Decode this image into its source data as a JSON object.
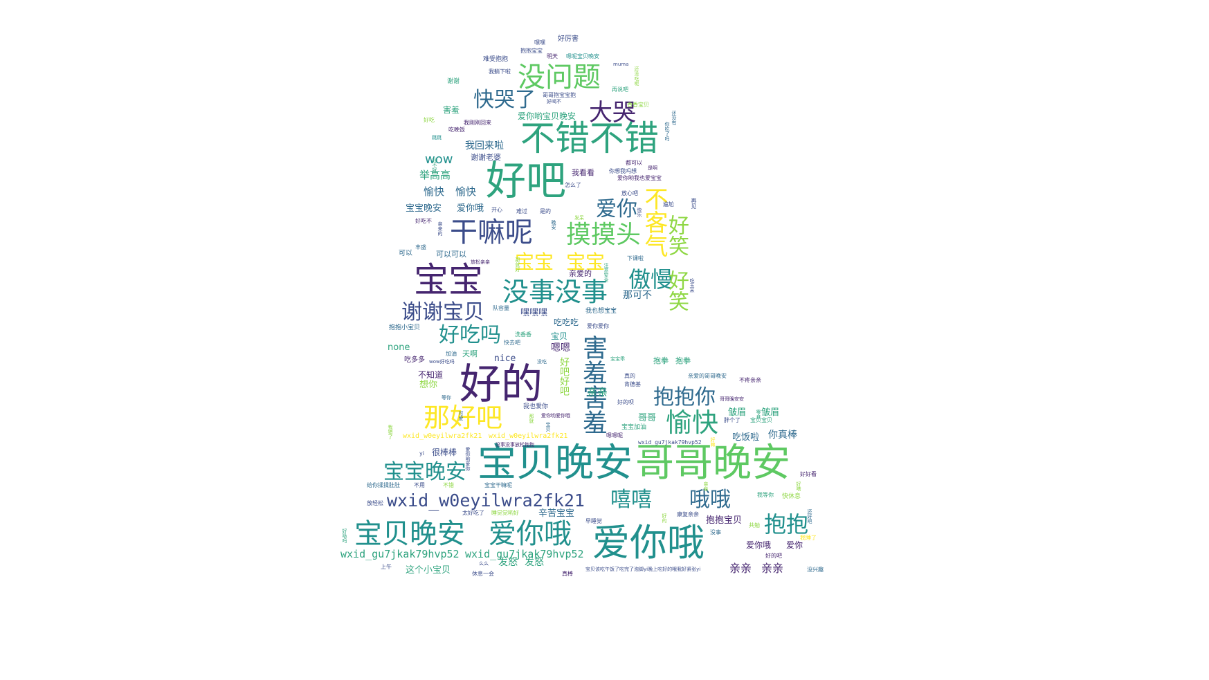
{
  "palette": {
    "dark_purple": "#45256f",
    "indigo": "#3b4c8a",
    "blue": "#2f6a8e",
    "teal": "#21908d",
    "green_teal": "#2ea37e",
    "green": "#5ec962",
    "light_green": "#8fd744",
    "yellow": "#fde725"
  },
  "words": [
    {
      "text": "宝贝晚安"
    },
    {
      "text": "哥哥晚安"
    },
    {
      "text": "好的"
    },
    {
      "text": "爱你哦"
    },
    {
      "text": "宝宝"
    },
    {
      "text": "好吧"
    },
    {
      "text": "不错不错"
    },
    {
      "text": "没问题"
    },
    {
      "text": "干嘛呢"
    },
    {
      "text": "摸摸头"
    },
    {
      "text": "没事没事"
    },
    {
      "text": "宝贝晚安"
    },
    {
      "text": "爱你哦"
    },
    {
      "text": "谢谢宝贝"
    },
    {
      "text": "好吃吗"
    },
    {
      "text": "那好吧"
    },
    {
      "text": "宝宝晚安"
    },
    {
      "text": "wxid_w0eyilwra2fk21"
    },
    {
      "text": "快哭了"
    },
    {
      "text": "大哭"
    },
    {
      "text": "爱你"
    },
    {
      "text": "宝宝"
    },
    {
      "text": "宝宝"
    },
    {
      "text": "傲慢"
    },
    {
      "text": "抱抱你"
    },
    {
      "text": "愉快"
    },
    {
      "text": "嘻嘻"
    },
    {
      "text": "哦哦"
    },
    {
      "text": "抱抱"
    },
    {
      "text": "害羞害羞"
    },
    {
      "text": "不客气"
    },
    {
      "text": "好笑"
    },
    {
      "text": "好笑"
    },
    {
      "text": "wxid_gu7jkak79hvp52"
    },
    {
      "text": "wxid_gu7jkak79hvp52"
    },
    {
      "text": "wow"
    },
    {
      "text": "我回来啦"
    },
    {
      "text": "谢谢老婆"
    },
    {
      "text": "举高高"
    },
    {
      "text": "愉快"
    },
    {
      "text": "愉快"
    },
    {
      "text": "宝宝晚安"
    },
    {
      "text": "爱你哦"
    },
    {
      "text": "爱你哟宝贝晚安"
    },
    {
      "text": "害羞"
    },
    {
      "text": "嘿嘿嘿"
    },
    {
      "text": "吃吃吃"
    },
    {
      "text": "那可不"
    },
    {
      "text": "嗯嗯"
    },
    {
      "text": "宝贝"
    },
    {
      "text": "好吧好吧"
    },
    {
      "text": "亲亲"
    },
    {
      "text": "哥哥"
    },
    {
      "text": "皱眉"
    },
    {
      "text": "皱眉"
    },
    {
      "text": "吃饭啦"
    },
    {
      "text": "你真棒"
    },
    {
      "text": "辛苦宝宝"
    },
    {
      "text": "抱抱宝贝"
    },
    {
      "text": "爱你哦"
    },
    {
      "text": "爱你"
    },
    {
      "text": "亲亲"
    },
    {
      "text": "亲亲"
    },
    {
      "text": "发怒"
    },
    {
      "text": "发怒"
    },
    {
      "text": "这个小宝贝"
    },
    {
      "text": "很棒棒"
    },
    {
      "text": "none"
    },
    {
      "text": "nice"
    },
    {
      "text": "天啊"
    },
    {
      "text": "吃多多"
    },
    {
      "text": "不知道"
    },
    {
      "text": "想你"
    },
    {
      "text": "抱拳"
    },
    {
      "text": "抱拳"
    },
    {
      "text": "可以可以"
    },
    {
      "text": "亲爱的"
    },
    {
      "text": "我看看"
    },
    {
      "text": "wxid_w0eyilwra2fk21"
    },
    {
      "text": "wxid_w0eyilwra2fk21"
    },
    {
      "text": "可以"
    },
    {
      "text": "好厉害"
    },
    {
      "text": "抱抱宝宝"
    },
    {
      "text": "嘿嘿"
    },
    {
      "text": "难受抱抱"
    },
    {
      "text": "明天"
    },
    {
      "text": "我躺下啦"
    },
    {
      "text": "嗯呢宝贝晚安"
    },
    {
      "text": "谢谢"
    },
    {
      "text": "muma"
    },
    {
      "text": "再说吧"
    },
    {
      "text": "哥哥抱宝宝抱"
    },
    {
      "text": "好喝不"
    },
    {
      "text": "香香宝贝"
    },
    {
      "text": "我刚刚回来"
    },
    {
      "text": "吃晚饭"
    },
    {
      "text": "好吃"
    },
    {
      "text": "跳跳"
    },
    {
      "text": "都可以"
    },
    {
      "text": "你想我吗想"
    },
    {
      "text": "是啊"
    },
    {
      "text": "爱你哟我也爱宝宝"
    },
    {
      "text": "怎么了"
    },
    {
      "text": "放心吧"
    },
    {
      "text": "开心"
    },
    {
      "text": "难过"
    },
    {
      "text": "是的"
    },
    {
      "text": "尴尬"
    },
    {
      "text": "好吃不"
    },
    {
      "text": "发呆"
    },
    {
      "text": "丰盛"
    },
    {
      "text": "放松亲亲"
    },
    {
      "text": "下课啦"
    },
    {
      "text": "队容量"
    },
    {
      "text": "我也想宝宝"
    },
    {
      "text": "爱你爱你"
    },
    {
      "text": "抱抱小宝贝"
    },
    {
      "text": "洗香香"
    },
    {
      "text": "快去吧"
    },
    {
      "text": "加油"
    },
    {
      "text": "wow好吃吗"
    },
    {
      "text": "没吃"
    },
    {
      "text": "宝宝乖"
    },
    {
      "text": "真的"
    },
    {
      "text": "肯德基"
    },
    {
      "text": "亲爱的哥哥晚安"
    },
    {
      "text": "不疼亲亲"
    },
    {
      "text": "等你"
    },
    {
      "text": "我也爱你"
    },
    {
      "text": "好的呗"
    },
    {
      "text": "哥哥晚安安"
    },
    {
      "text": "爱你哟爱你哦"
    },
    {
      "text": "宝宝加油"
    },
    {
      "text": "嗯嗯呢"
    },
    {
      "text": "胖个了"
    },
    {
      "text": "宝贝宝贝"
    },
    {
      "text": "wxid_gu7jkak79hvp52"
    },
    {
      "text": "没事没事放松抱抱"
    },
    {
      "text": "yi"
    },
    {
      "text": "好好看"
    },
    {
      "text": "给你揉揉肚肚"
    },
    {
      "text": "不用"
    },
    {
      "text": "不错"
    },
    {
      "text": "宝宝干嘛呢"
    },
    {
      "text": "我等你"
    },
    {
      "text": "快休息"
    },
    {
      "text": "放轻松"
    },
    {
      "text": "太好吃了"
    },
    {
      "text": "睡觉觉哟好"
    },
    {
      "text": "早睡觉"
    },
    {
      "text": "康复亲亲"
    },
    {
      "text": "没事"
    },
    {
      "text": "共勉"
    },
    {
      "text": "我睡了"
    },
    {
      "text": "好的吧"
    },
    {
      "text": "上午"
    },
    {
      "text": "么么"
    },
    {
      "text": "休息一会"
    },
    {
      "text": "真棒"
    },
    {
      "text": "宝贝该吃午饭了吃完了泡脚yi晚上吃好的哦我好紧张yi"
    },
    {
      "text": "没兴趣"
    },
    {
      "text": "亲来的"
    },
    {
      "text": "好不好"
    },
    {
      "text": "你吃了吗"
    },
    {
      "text": "还没有"
    },
    {
      "text": "还没吃呢"
    },
    {
      "text": "那就好"
    },
    {
      "text": "再见"
    },
    {
      "text": "吃玉米"
    },
    {
      "text": "晚安"
    },
    {
      "text": "注意安全"
    },
    {
      "text": "我错了"
    },
    {
      "text": "好哒吗"
    },
    {
      "text": "还好吧"
    },
    {
      "text": "好嗒"
    },
    {
      "text": "可爱"
    },
    {
      "text": "爱你哟爱你"
    },
    {
      "text": "那就"
    },
    {
      "text": "好的"
    },
    {
      "text": "好嘛"
    },
    {
      "text": "宝贝"
    },
    {
      "text": "零食"
    },
    {
      "text": "亲亲"
    },
    {
      "text": "快乐"
    },
    {
      "text": "困"
    }
  ]
}
